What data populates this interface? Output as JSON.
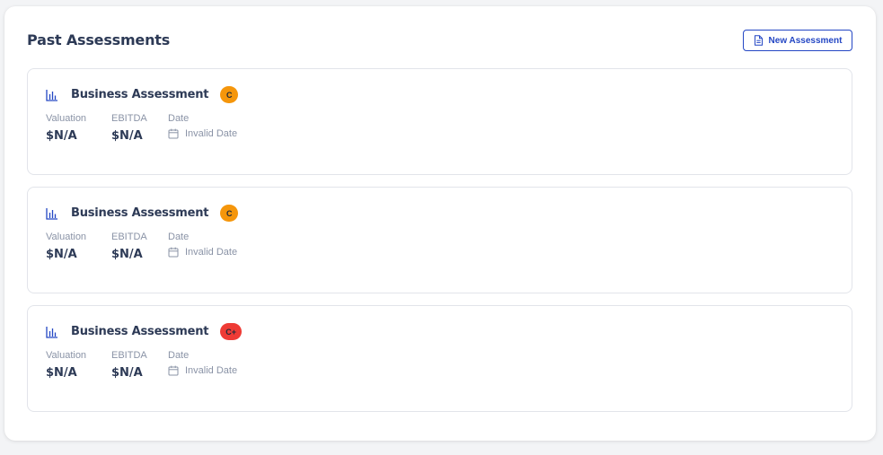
{
  "header": {
    "title": "Past Assessments",
    "new_button_label": "New Assessment",
    "new_button_icon": "document-icon",
    "accent": "#2447c4"
  },
  "assessments": [
    {
      "title": "Business Assessment",
      "grade": "C",
      "grade_color": "#f5960b",
      "valuation_label": "Valuation",
      "valuation": "$N/A",
      "ebitda_label": "EBITDA",
      "ebitda": "$N/A",
      "date_label": "Date",
      "date": "Invalid Date"
    },
    {
      "title": "Business Assessment",
      "grade": "C",
      "grade_color": "#f5960b",
      "valuation_label": "Valuation",
      "valuation": "$N/A",
      "ebitda_label": "EBITDA",
      "ebitda": "$N/A",
      "date_label": "Date",
      "date": "Invalid Date"
    },
    {
      "title": "Business Assessment",
      "grade": "C+",
      "grade_color": "#ee3b35",
      "valuation_label": "Valuation",
      "valuation": "$N/A",
      "ebitda_label": "EBITDA",
      "ebitda": "$N/A",
      "date_label": "Date",
      "date": "Invalid Date"
    }
  ]
}
